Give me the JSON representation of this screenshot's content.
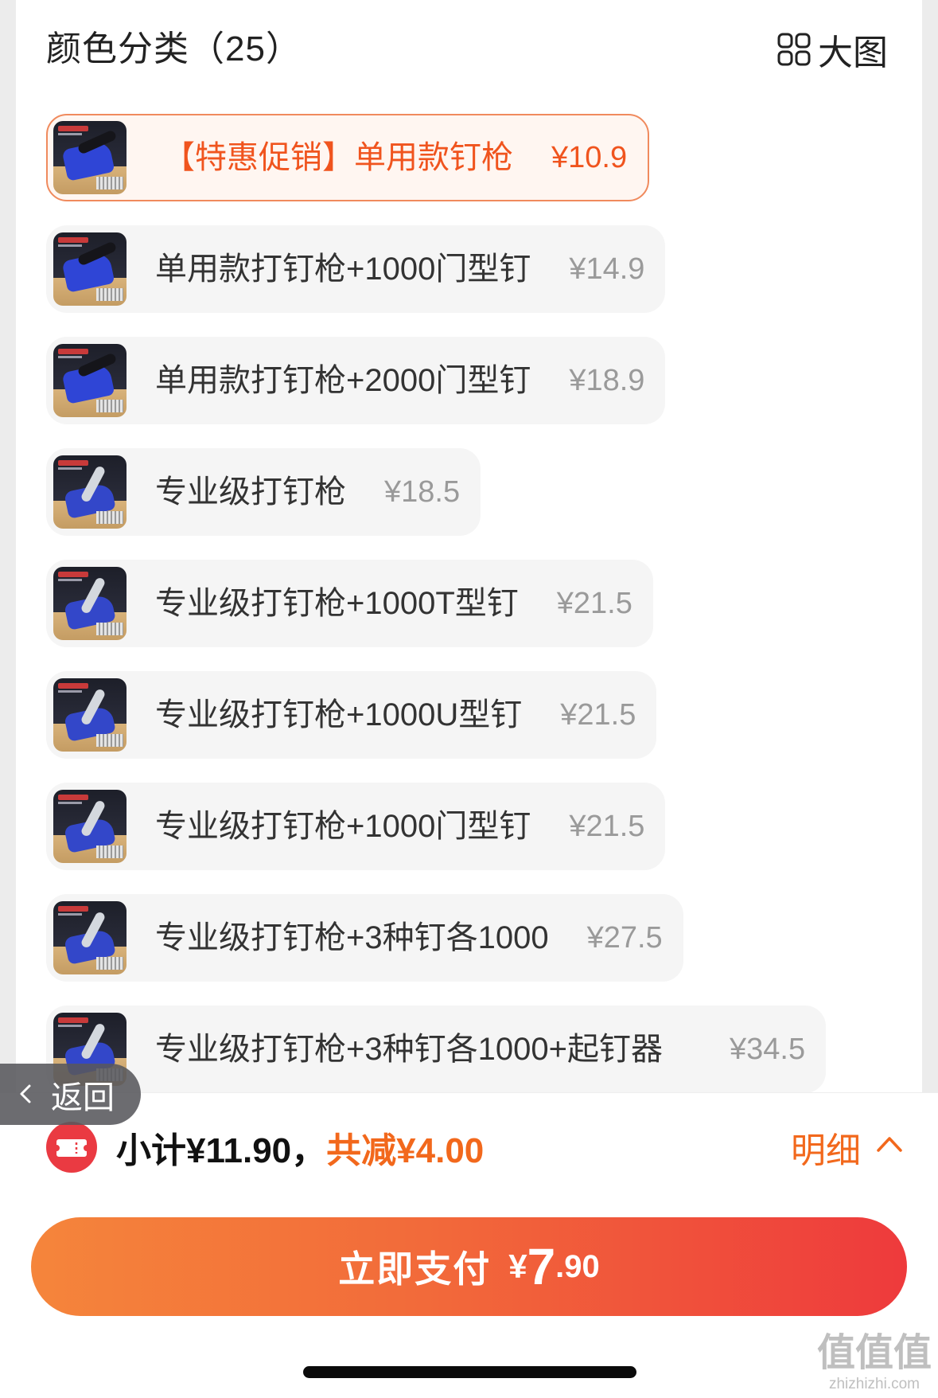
{
  "header": {
    "title": "颜色分类（25）",
    "view_label": "大图",
    "view_icon": "grid-icon"
  },
  "options": [
    {
      "label": "【特惠促销】单用款钉枪",
      "price": "¥10.9",
      "selected": true
    },
    {
      "label": "单用款打钉枪+1000门型钉",
      "price": "¥14.9",
      "selected": false
    },
    {
      "label": "单用款打钉枪+2000门型钉",
      "price": "¥18.9",
      "selected": false
    },
    {
      "label": "专业级打钉枪",
      "price": "¥18.5",
      "selected": false
    },
    {
      "label": "专业级打钉枪+1000T型钉",
      "price": "¥21.5",
      "selected": false
    },
    {
      "label": "专业级打钉枪+1000U型钉",
      "price": "¥21.5",
      "selected": false
    },
    {
      "label": "专业级打钉枪+1000门型钉",
      "price": "¥21.5",
      "selected": false
    },
    {
      "label": "专业级打钉枪+3种钉各1000",
      "price": "¥27.5",
      "selected": false
    },
    {
      "label": "专业级打钉枪+3种钉各1000+起钉器",
      "price": "¥34.5",
      "selected": false
    }
  ],
  "back_button": {
    "label": "返回",
    "icon": "chevron-left-icon"
  },
  "summary": {
    "subtotal": "小计¥11.90，",
    "discount": "共减¥4.00",
    "detail_label": "明细",
    "detail_icon": "chevron-up-icon",
    "coupon_icon": "coupon-icon"
  },
  "pay_button": {
    "label": "立即支付",
    "currency": "¥",
    "amount_int": "7",
    "amount_dec": ".90"
  },
  "watermark": {
    "glyphs": "值值值",
    "site": "zhizhizhi.com"
  },
  "colors": {
    "accent": "#f2681c",
    "selected_text": "#f0541e",
    "selected_border": "#f08a5d",
    "pay_gradient_start": "#f5853b",
    "pay_gradient_end": "#ee3a3c",
    "coupon_red": "#ea3a42"
  }
}
